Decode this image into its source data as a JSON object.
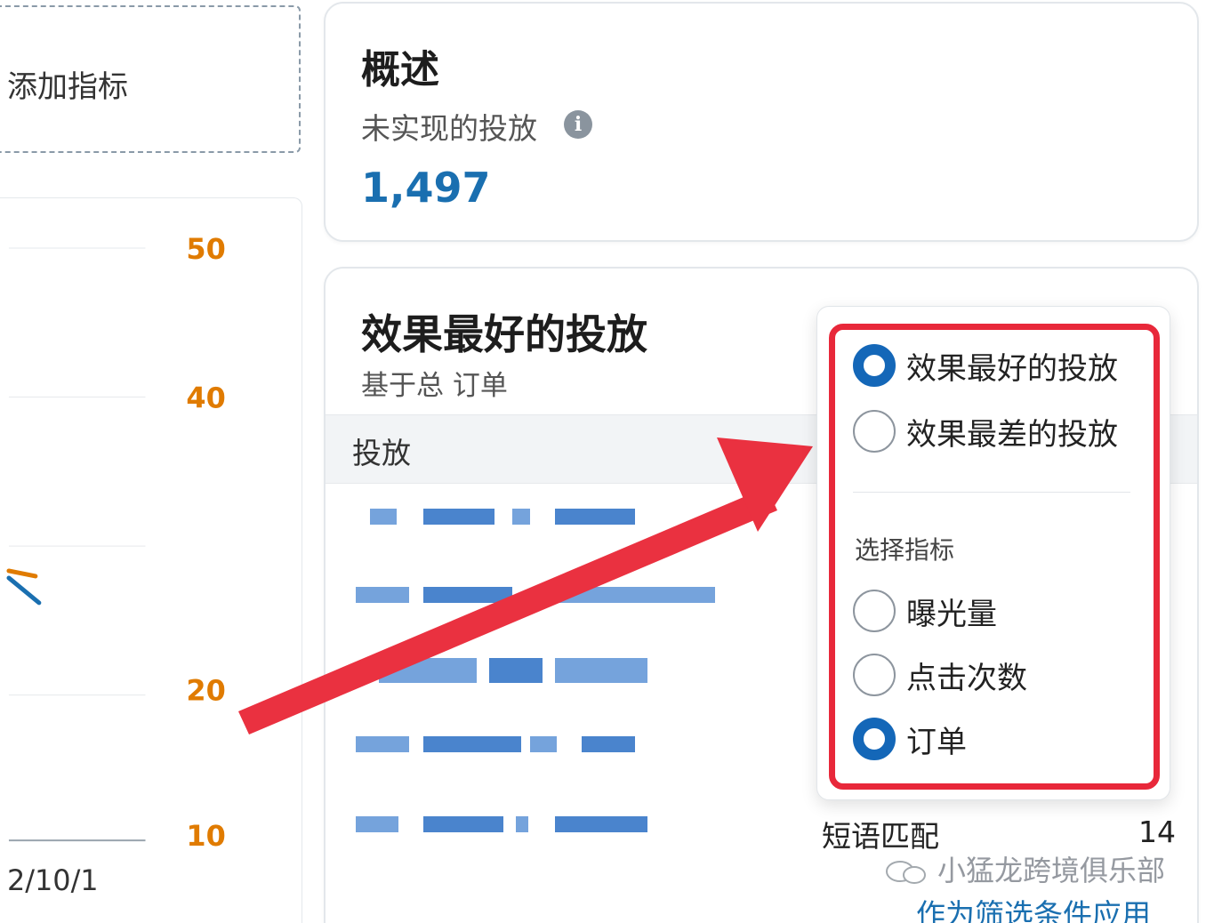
{
  "add_metric": {
    "label": "添加指标"
  },
  "chart": {
    "y_ticks": [
      "50",
      "40",
      "20",
      "10"
    ],
    "x_tick": "2/10/1",
    "tick_color": "#e07b00",
    "line_colors": [
      "#e07b00",
      "#1a6fb0"
    ]
  },
  "overview": {
    "title": "概述",
    "subtitle": "未实现的投放",
    "info_icon": "i",
    "value": "1,497"
  },
  "performance": {
    "title": "效果最好的投放",
    "subtitle": "基于总 订单",
    "table_header": "投放",
    "visible_row_label": "短语匹配",
    "visible_row_value": "14",
    "filter_link": "作为筛选条件应用"
  },
  "dropdown": {
    "sort_options": [
      {
        "label": "效果最好的投放",
        "checked": true
      },
      {
        "label": "效果最差的投放",
        "checked": false
      }
    ],
    "section_label": "选择指标",
    "metric_options": [
      {
        "label": "曝光量",
        "checked": false
      },
      {
        "label": "点击次数",
        "checked": false
      },
      {
        "label": "订单",
        "checked": true
      }
    ],
    "accent_color": "#1467b8",
    "highlight_color": "#e8283a"
  },
  "watermark": {
    "text": "小猛龙跨境俱乐部",
    "icon": "wechat-icon"
  }
}
